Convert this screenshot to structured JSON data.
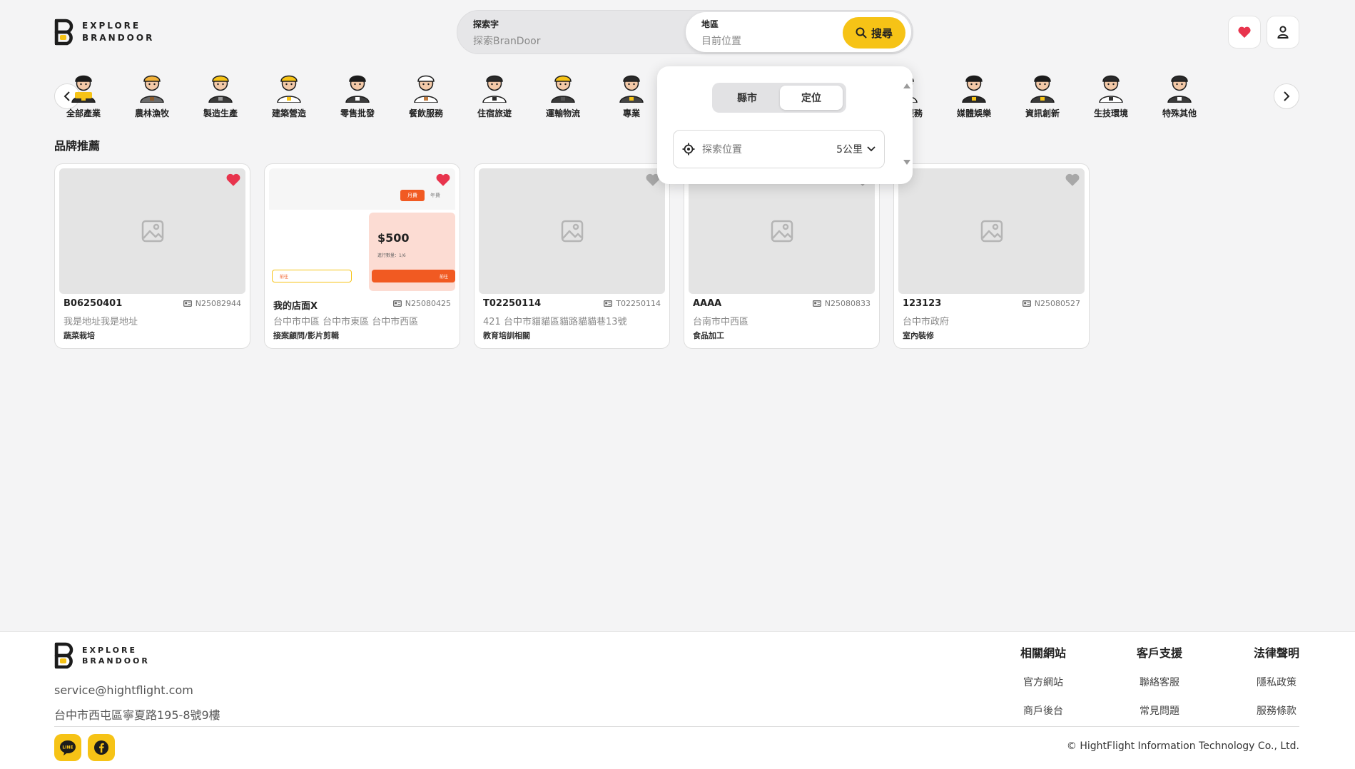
{
  "brand": {
    "line1": "EXPLORE",
    "line2": "BRANDOOR"
  },
  "search": {
    "keyword_label": "探索字",
    "keyword_placeholder": "探索BranDoor",
    "region_label": "地區",
    "region_placeholder": "目前位置",
    "button_label": "搜尋"
  },
  "categories": [
    "全部產業",
    "農林漁牧",
    "製造生產",
    "建築營造",
    "零售批發",
    "餐飲服務",
    "住宿旅遊",
    "運輸物流",
    "專業",
    "生活服務",
    "媒體娛樂",
    "資訊創新",
    "生技環境",
    "特殊其他"
  ],
  "section_title": "品牌推薦",
  "cards": [
    {
      "name": "B06250401",
      "code": "N25082944",
      "address": "我是地址我是地址",
      "tag": "蔬菜栽培",
      "favorite": true
    },
    {
      "name": "我的店面X",
      "code": "N25080425",
      "address": "台中市中區 台中市東區 台中市西區",
      "tag": "接案顧問/影片剪輯",
      "favorite": true,
      "preview": {
        "tab_active": "月費",
        "tab_other": "年費",
        "price": "$500",
        "price_caption": "進行數量：1/6",
        "button_label": "前往",
        "left_button_label": "前往"
      }
    },
    {
      "name": "T02250114",
      "code": "T02250114",
      "address": "421 台中市貓貓區貓路貓貓巷13號",
      "tag": "教育培訓相關",
      "favorite": false
    },
    {
      "name": "AAAA",
      "code": "N25080833",
      "address": "台南市中西區",
      "tag": "食品加工",
      "favorite": false
    },
    {
      "name": "123123",
      "code": "N25080527",
      "address": "台中市政府",
      "tag": "室內裝修",
      "favorite": false
    }
  ],
  "dropdown": {
    "tab_city": "縣市",
    "tab_location": "定位",
    "active_tab": "定位",
    "location_placeholder": "探索位置",
    "radius": "5公里"
  },
  "footer": {
    "email": "service@hightflight.com",
    "address": "台中市西屯區寧夏路195-8號9樓",
    "columns": [
      {
        "title": "相關網站",
        "links": [
          "官方網站",
          "商戶後台"
        ]
      },
      {
        "title": "客戶支援",
        "links": [
          "聯絡客服",
          "常見問題"
        ]
      },
      {
        "title": "法律聲明",
        "links": [
          "隱私政策",
          "服務條款"
        ]
      }
    ],
    "social": {
      "line": "LINE"
    },
    "copyright": "© HightFlight Information Technology Co., Ltd."
  },
  "colors": {
    "accent": "#f6c316",
    "heart_active": "#e8344d",
    "heart_inactive": "#a8a8a8",
    "orange": "#f15a22"
  },
  "icons": [
    "chevron-left-icon",
    "chevron-right-icon",
    "heart-icon",
    "user-icon",
    "search-icon",
    "locate-icon",
    "chevron-down-icon",
    "image-placeholder-icon",
    "id-card-icon",
    "line-icon",
    "facebook-icon"
  ]
}
